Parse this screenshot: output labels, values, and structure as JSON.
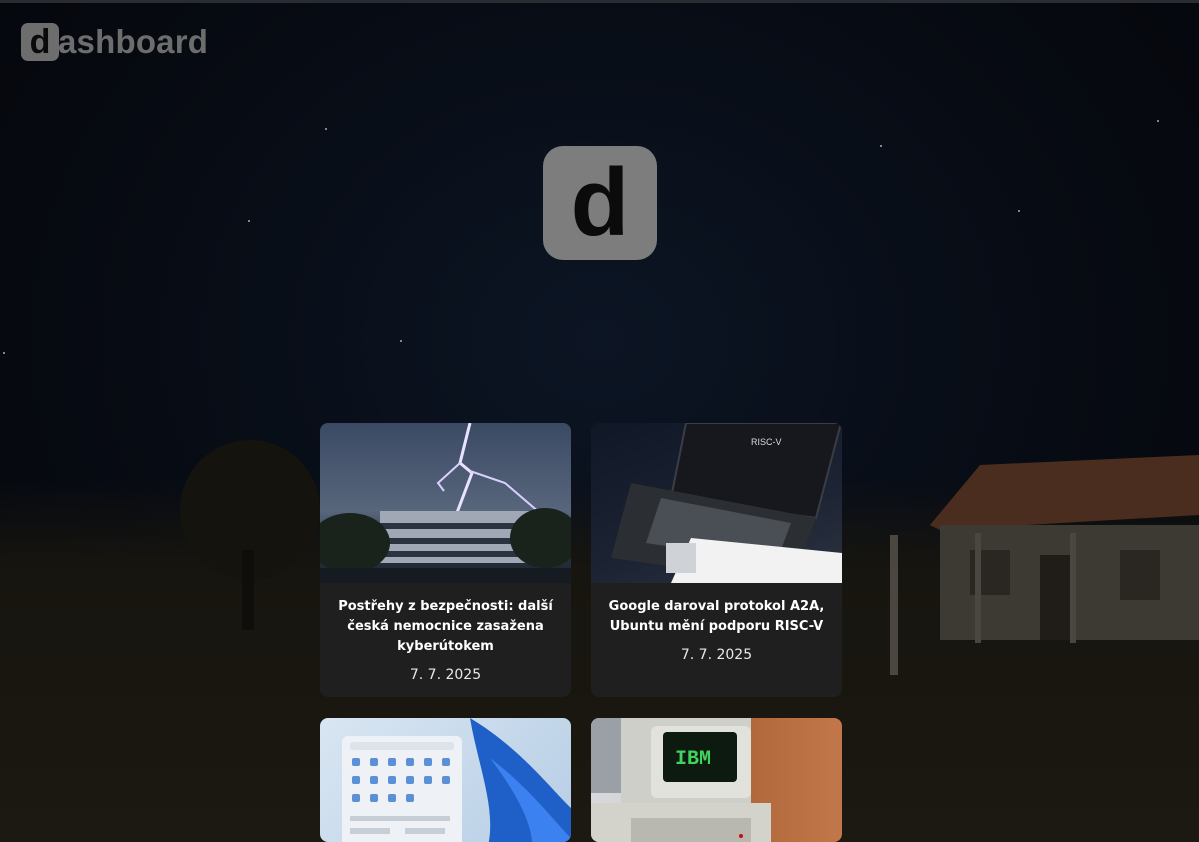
{
  "brand": {
    "initial": "d",
    "rest": "ashboard"
  },
  "logo": {
    "letter": "d"
  },
  "cards": [
    {
      "title": "Postřehy z bezpečnosti: další česká nemocnice zasažena kyberútokem",
      "date": "7. 7. 2025",
      "image": "lightning-over-hospital"
    },
    {
      "title": "Google daroval protokol A2A, Ubuntu mění podporu RISC-V",
      "date": "7. 7. 2025",
      "image": "risc-v-laptop"
    },
    {
      "title": "",
      "date": "",
      "image": "windows-start-menu"
    },
    {
      "title": "",
      "date": "",
      "image": "ibm-pc-monitor"
    }
  ],
  "thumb_labels": {
    "risc": "RISC-V",
    "ibm": "IBM"
  },
  "colors": {
    "background": "#05070c",
    "card": "#1f1f1f",
    "logo": "#7d7d7d"
  }
}
